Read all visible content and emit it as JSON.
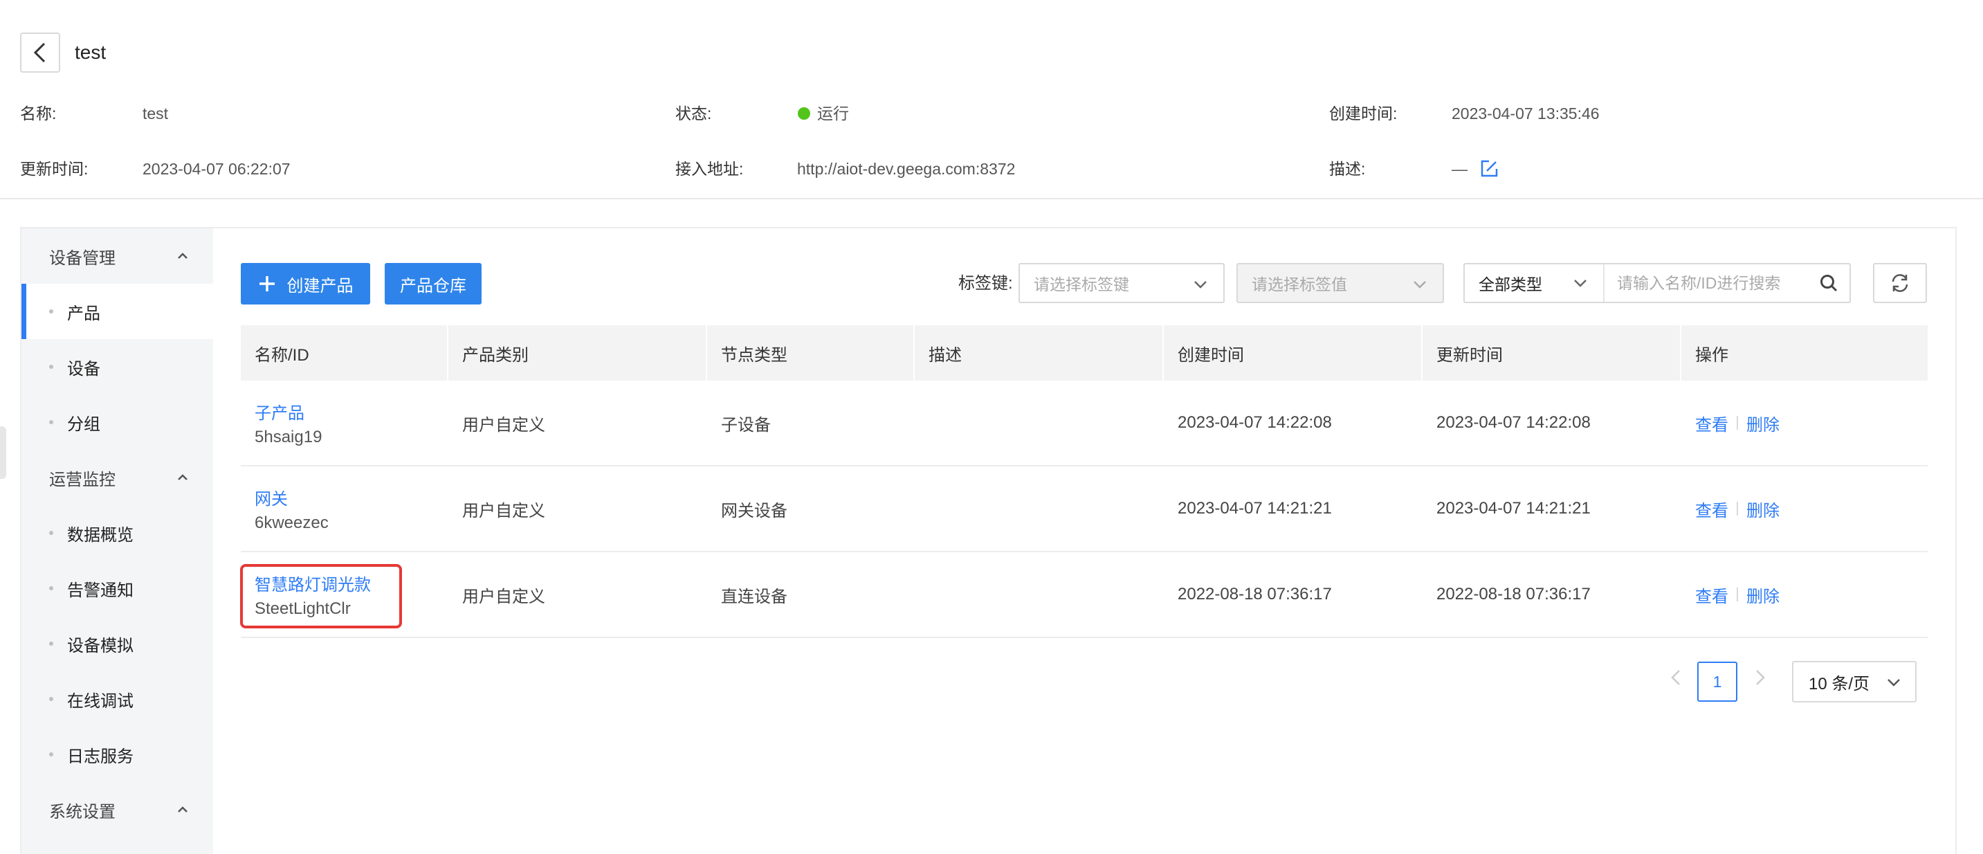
{
  "header": {
    "title": "test",
    "fields": {
      "name_label": "名称:",
      "name_value": "test",
      "status_label": "状态:",
      "status_value": "运行",
      "status_color": "#52c41a",
      "created_label": "创建时间:",
      "created_value": "2023-04-07 13:35:46",
      "updated_label": "更新时间:",
      "updated_value": "2023-04-07 06:22:07",
      "endpoint_label": "接入地址:",
      "endpoint_value": "http://aiot-dev.geega.com:8372",
      "desc_label": "描述:",
      "desc_value": "—"
    }
  },
  "sidebar": {
    "groups": [
      {
        "label": "设备管理",
        "items": [
          "产品",
          "设备",
          "分组"
        ]
      },
      {
        "label": "运营监控",
        "items": [
          "数据概览",
          "告警通知",
          "设备模拟",
          "在线调试",
          "日志服务"
        ]
      },
      {
        "label": "系统设置",
        "items": []
      }
    ],
    "active_item": "产品"
  },
  "toolbar": {
    "create_label": "创建产品",
    "warehouse_label": "产品仓库",
    "tag_key_label": "标签键:",
    "tag_key_placeholder": "请选择标签键",
    "tag_value_placeholder": "请选择标签值",
    "type_selected": "全部类型",
    "search_placeholder": "请输入名称/ID进行搜索"
  },
  "table": {
    "columns": [
      "名称/ID",
      "产品类别",
      "节点类型",
      "描述",
      "创建时间",
      "更新时间",
      "操作"
    ],
    "rows": [
      {
        "name": "子产品",
        "id": "5hsaig19",
        "category": "用户自定义",
        "node_type": "子设备",
        "description": "",
        "created": "2023-04-07 14:22:08",
        "updated": "2023-04-07 14:22:08",
        "actions": [
          "查看",
          "删除"
        ]
      },
      {
        "name": "网关",
        "id": "6kweezec",
        "category": "用户自定义",
        "node_type": "网关设备",
        "description": "",
        "created": "2023-04-07 14:21:21",
        "updated": "2023-04-07 14:21:21",
        "actions": [
          "查看",
          "删除"
        ]
      },
      {
        "name": "智慧路灯调光款",
        "id": "SteetLightClr",
        "category": "用户自定义",
        "node_type": "直连设备",
        "description": "",
        "created": "2022-08-18 07:36:17",
        "updated": "2022-08-18 07:36:17",
        "actions": [
          "查看",
          "删除"
        ]
      }
    ]
  },
  "pagination": {
    "current_page": "1",
    "page_size": "10 条/页"
  },
  "colors": {
    "accent": "#2e7cf6",
    "primary_button": "#2e84ea",
    "highlight": "#e53935"
  }
}
